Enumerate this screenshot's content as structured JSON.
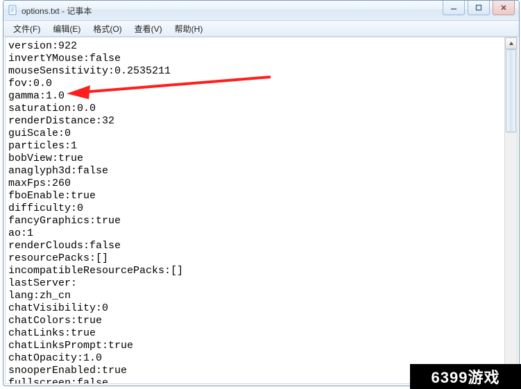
{
  "window": {
    "title": "options.txt - 记事本"
  },
  "menu": {
    "file": "文件(F)",
    "edit": "编辑(E)",
    "format": "格式(O)",
    "view": "查看(V)",
    "help": "帮助(H)"
  },
  "lines": [
    "version:922",
    "invertYMouse:false",
    "mouseSensitivity:0.2535211",
    "fov:0.0",
    "gamma:1.0",
    "saturation:0.0",
    "renderDistance:32",
    "guiScale:0",
    "particles:1",
    "bobView:true",
    "anaglyph3d:false",
    "maxFps:260",
    "fboEnable:true",
    "difficulty:0",
    "fancyGraphics:true",
    "ao:1",
    "renderClouds:false",
    "resourcePacks:[]",
    "incompatibleResourcePacks:[]",
    "lastServer:",
    "lang:zh_cn",
    "chatVisibility:0",
    "chatColors:true",
    "chatLinks:true",
    "chatLinksPrompt:true",
    "chatOpacity:1.0",
    "snooperEnabled:true",
    "fullscreen:false"
  ],
  "watermark": "6399游戏"
}
